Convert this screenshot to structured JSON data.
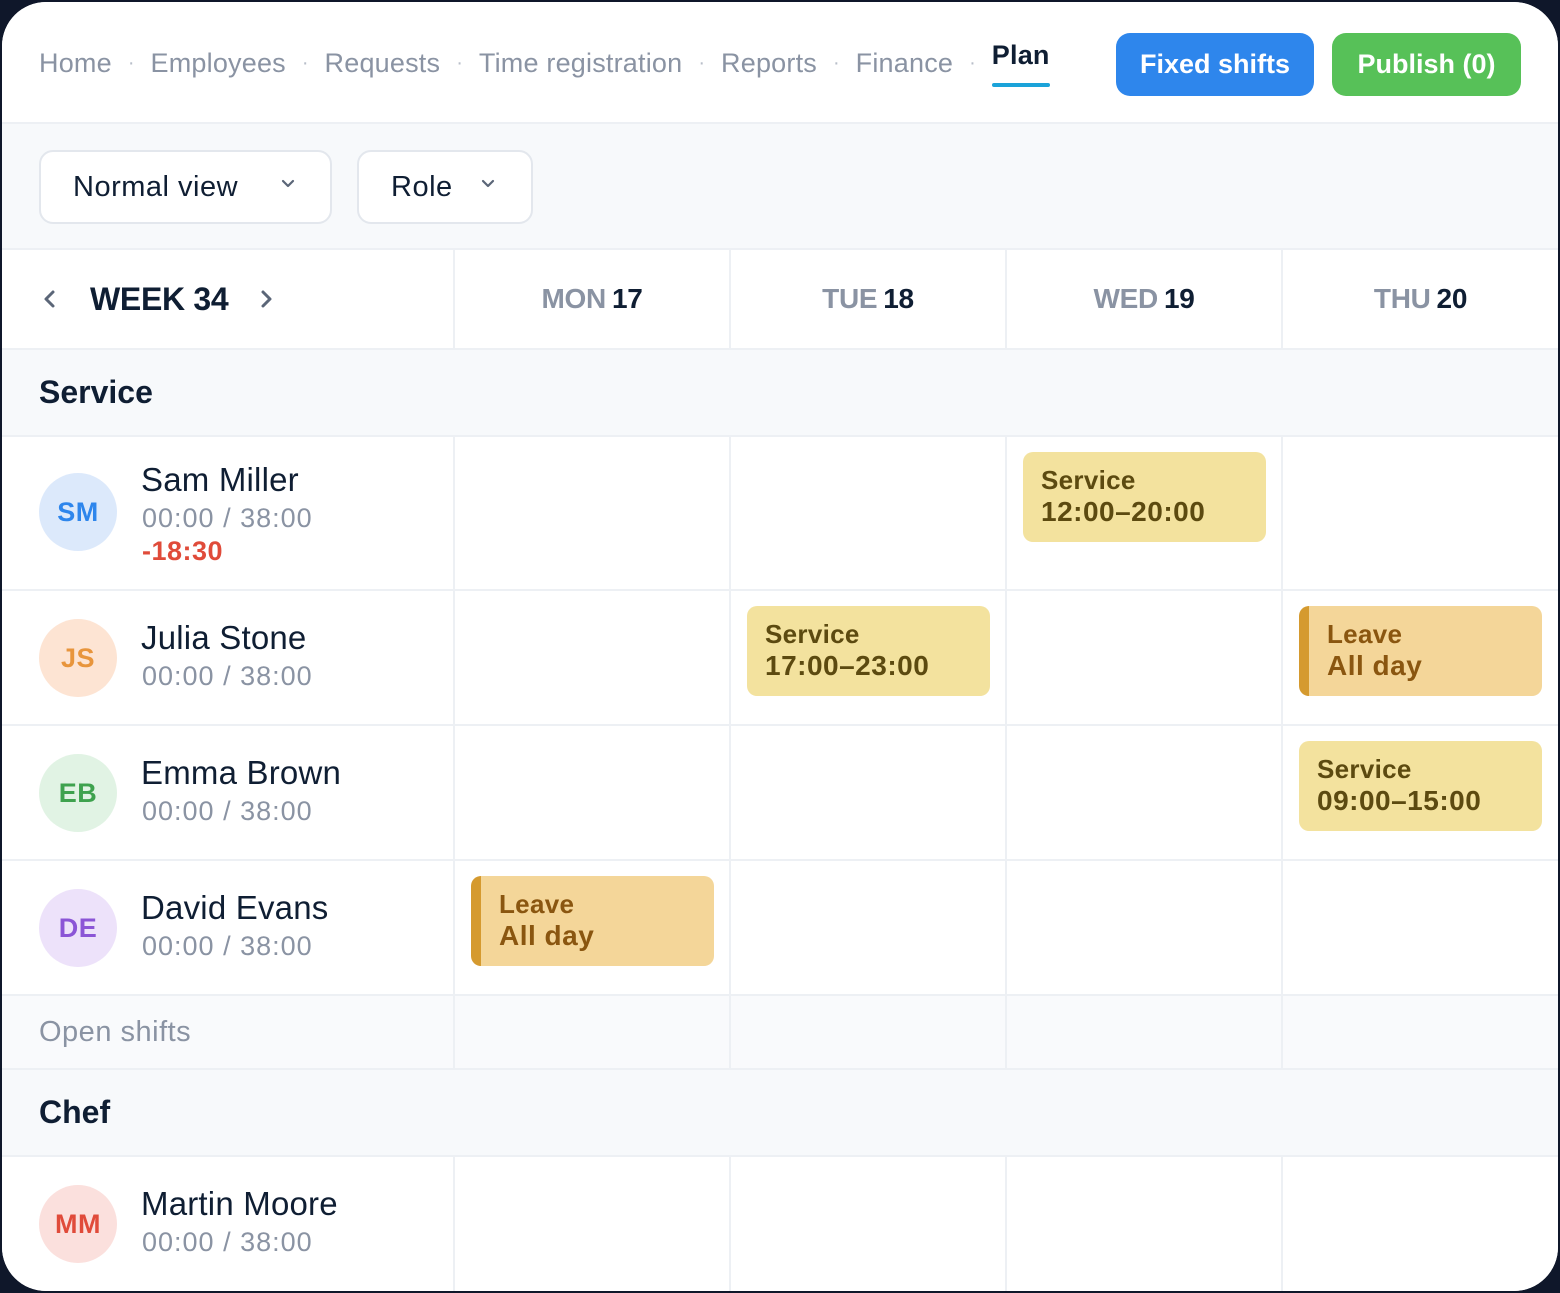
{
  "nav": {
    "items": [
      {
        "label": "Home"
      },
      {
        "label": "Employees"
      },
      {
        "label": "Requests"
      },
      {
        "label": "Time registration"
      },
      {
        "label": "Reports"
      },
      {
        "label": "Finance"
      },
      {
        "label": "Plan"
      }
    ],
    "separator": "·",
    "active": "Plan",
    "fixed_shifts_label": "Fixed shifts",
    "publish_label": "Publish (0)"
  },
  "filters": {
    "view": "Normal view",
    "role": "Role"
  },
  "week": {
    "label": "WEEK 34",
    "days": [
      {
        "name": "MON",
        "num": "17"
      },
      {
        "name": "TUE",
        "num": "18"
      },
      {
        "name": "WED",
        "num": "19"
      },
      {
        "name": "THU",
        "num": "20"
      }
    ]
  },
  "sections": [
    {
      "title": "Service",
      "employees": [
        {
          "initials": "SM",
          "name": "Sam Miller",
          "hours": "00:00 / 38:00",
          "diff": "-18:30"
        },
        {
          "initials": "JS",
          "name": "Julia Stone",
          "hours": "00:00 / 38:00"
        },
        {
          "initials": "EB",
          "name": "Emma Brown",
          "hours": "00:00 / 38:00"
        },
        {
          "initials": "DE",
          "name": "David Evans",
          "hours": "00:00 / 38:00"
        }
      ],
      "open_label": "Open shifts"
    },
    {
      "title": "Chef",
      "employees": [
        {
          "initials": "MM",
          "name": "Martin Moore",
          "hours": "00:00 / 38:00"
        }
      ]
    }
  ],
  "shifts": {
    "sam_wed": {
      "type": "Service",
      "time": "12:00–20:00"
    },
    "julia_tue": {
      "type": "Service",
      "time": "17:00–23:00"
    },
    "julia_thu": {
      "type": "Leave",
      "time": "All day"
    },
    "emma_thu": {
      "type": "Service",
      "time": "09:00–15:00"
    },
    "david_mon": {
      "type": "Leave",
      "time": "All day"
    }
  },
  "colors": {
    "primary_button": "#2e86ec",
    "publish_button": "#57c158",
    "active_underline": "#1ba3d9",
    "service_shift": "#f3e29e",
    "leave_shift": "#f4d699",
    "negative_hours": "#e04b3a"
  },
  "icons": {
    "prev_week": "chevron-left-icon",
    "next_week": "chevron-right-icon",
    "dropdown": "chevron-down-icon"
  }
}
